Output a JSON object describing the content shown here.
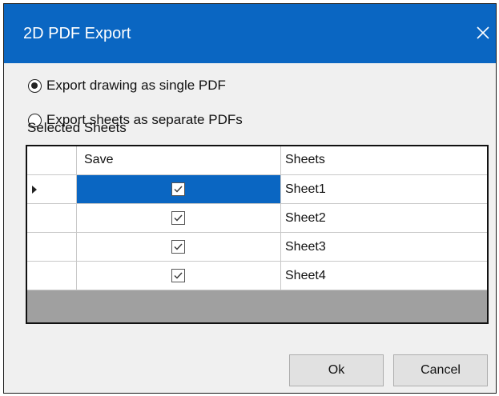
{
  "window": {
    "title": "2D PDF Export",
    "close_label": "✕",
    "titlebar_color": "#0a66c2"
  },
  "export_options": [
    {
      "label": "Export drawing as single PDF",
      "selected": true
    },
    {
      "label": "Export sheets as separate PDFs",
      "selected": false
    }
  ],
  "selected_sheets": {
    "label": "Selected Sheets",
    "columns": [
      "Save",
      "Sheets"
    ],
    "rows": [
      {
        "save": true,
        "sheet": "Sheet1",
        "current": true
      },
      {
        "save": true,
        "sheet": "Sheet2",
        "current": false
      },
      {
        "save": true,
        "sheet": "Sheet3",
        "current": false
      },
      {
        "save": true,
        "sheet": "Sheet4",
        "current": false
      }
    ]
  },
  "buttons": {
    "ok_label": "Ok",
    "cancel_label": "Cancel"
  },
  "icons": {
    "radio": "radio-icon",
    "checkbox": "checkbox-icon",
    "row_pointer": "row-pointer-icon",
    "close": "close-icon"
  }
}
